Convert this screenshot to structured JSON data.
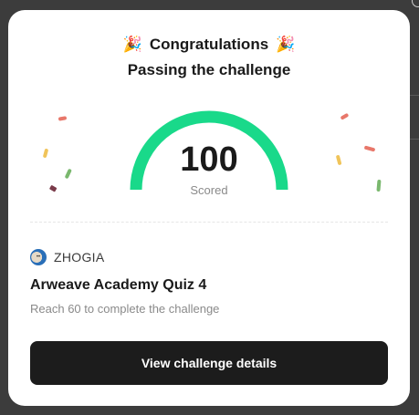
{
  "modal": {
    "title": "Congratulations",
    "subtitle": "Passing the challenge",
    "title_emoji": "🎉"
  },
  "score": {
    "value": "100",
    "label": "Scored",
    "max": 100,
    "gauge_color": "#19d98a"
  },
  "challenge": {
    "organizer": "ZHOGIA",
    "name": "Arweave Academy Quiz 4",
    "requirement": "Reach 60 to complete the challenge"
  },
  "cta": {
    "label": "View challenge details"
  },
  "colors": {
    "button_bg": "#1c1c1c",
    "confetti": [
      "#e8776a",
      "#f0c45a",
      "#7ab86e",
      "#7a3b4a"
    ]
  }
}
